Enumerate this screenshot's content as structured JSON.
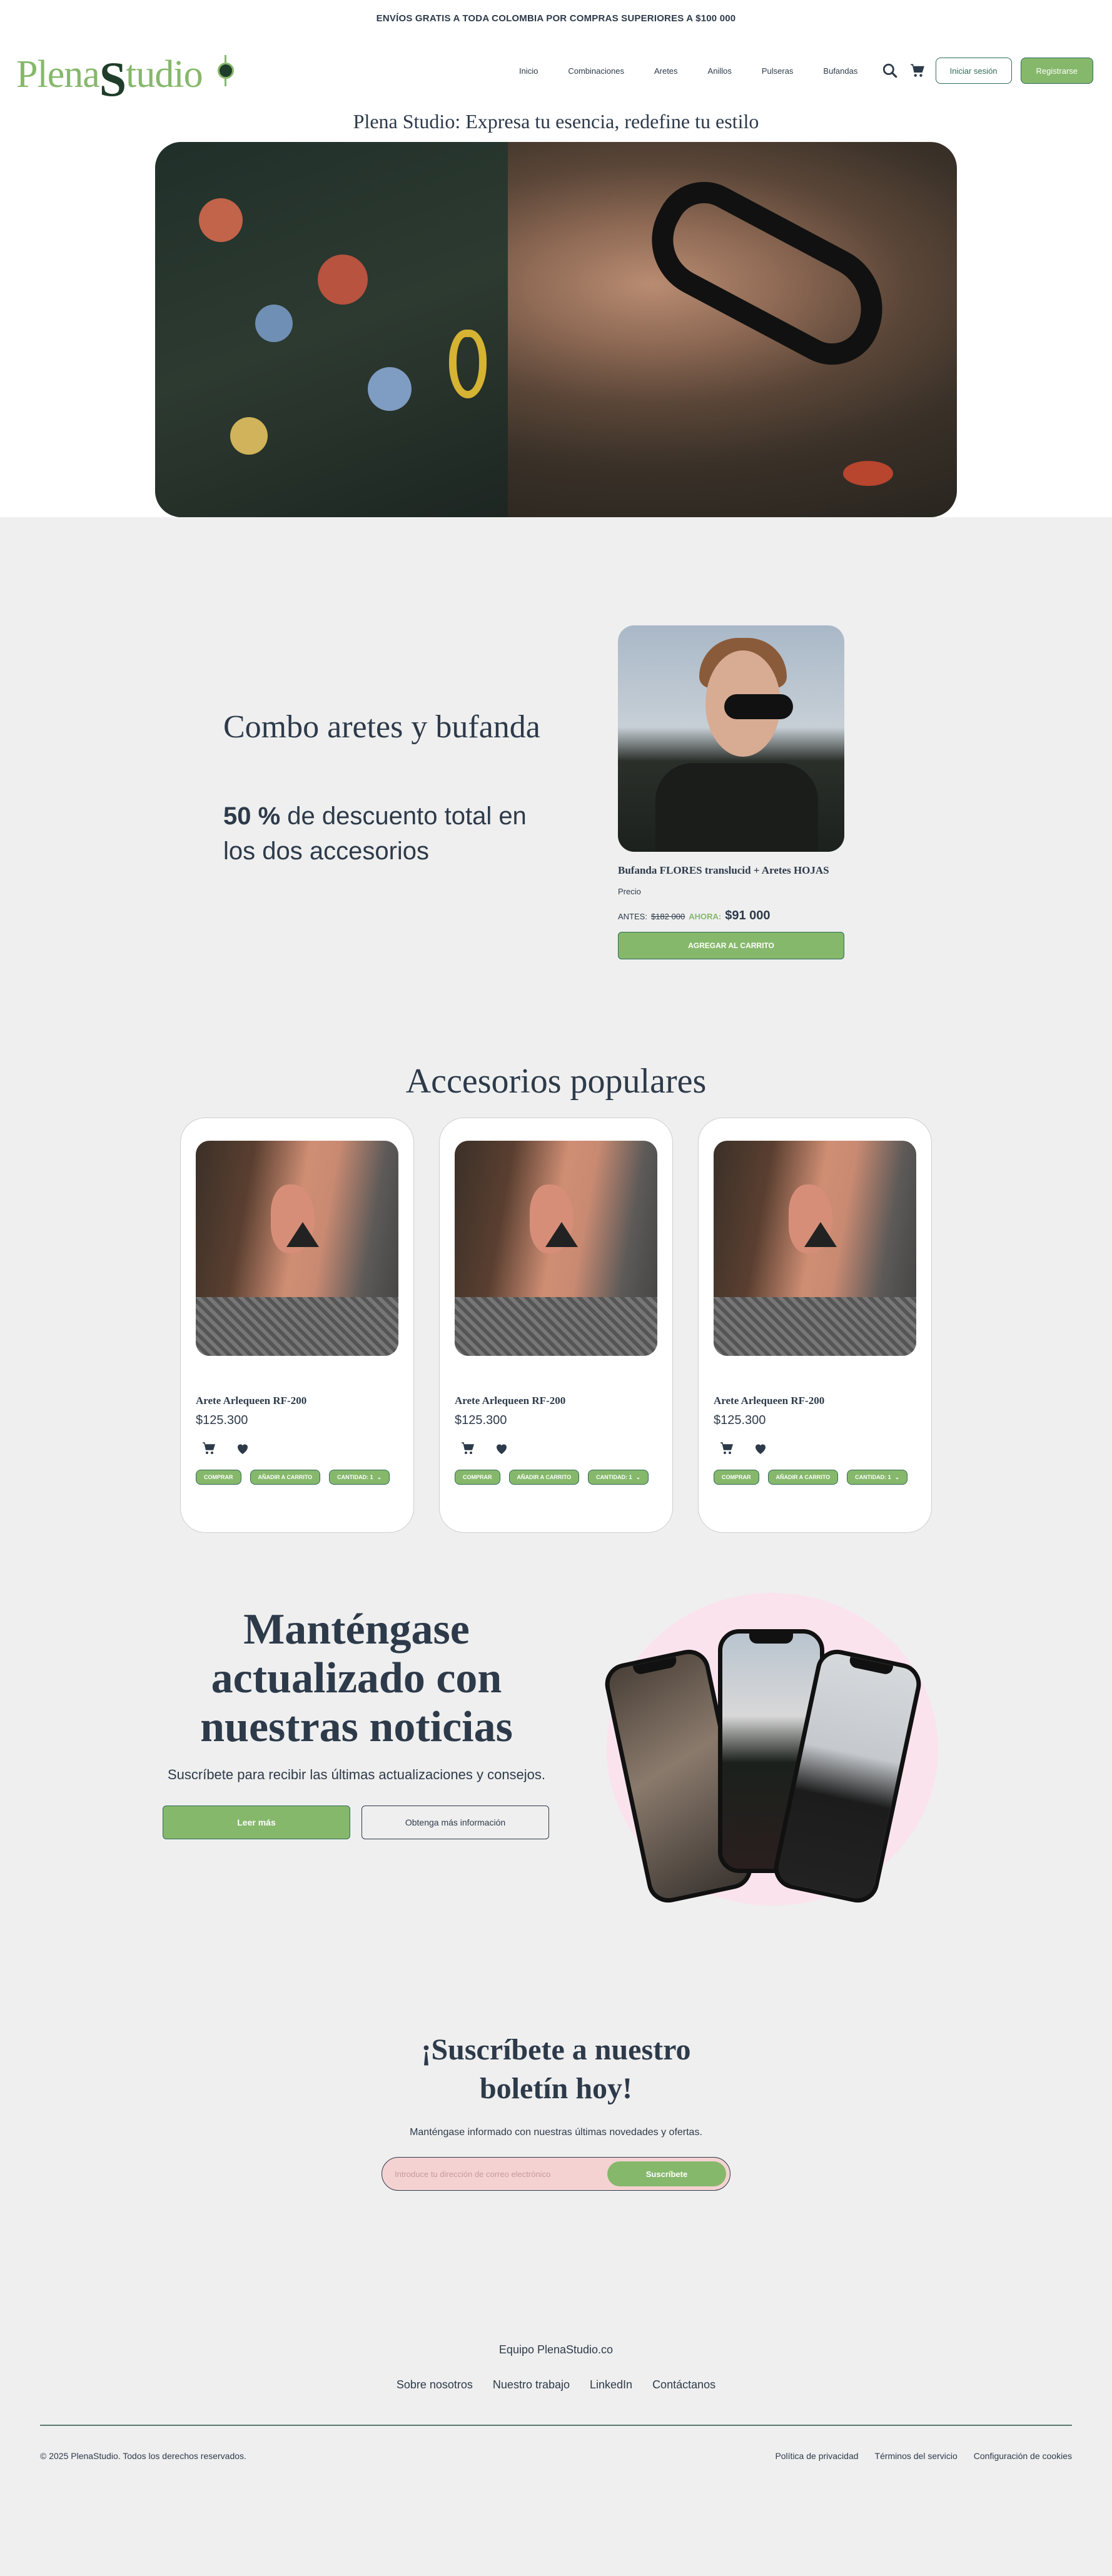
{
  "banner": {
    "text": "ENVÍOS GRATIS A TODA COLOMBIA POR COMPRAS SUPERIORES A $100 000"
  },
  "header": {
    "logo_text_a": "Plena",
    "logo_text_s": "S",
    "logo_text_b": "tudio",
    "nav": [
      "Inicio",
      "Combinaciones",
      "Aretes",
      "Anillos",
      "Pulseras",
      "Bufandas"
    ],
    "login_label": "Iniciar sesión",
    "register_label": "Registrarse"
  },
  "hero": {
    "title": "Plena Studio: Expresa tu esencia, redefine tu estilo"
  },
  "combo": {
    "title": "Combo aretes y bufanda",
    "desc_bold": "50 %",
    "desc_rest": " de descuento total en los dos accesorios",
    "product_name": "Bufanda FLORES translucid + Aretes HOJAS",
    "price_label": "Precio",
    "before_label": "ANTES:",
    "before_price": "$182 000",
    "now_label": "AHORA:",
    "now_price": "$91 000",
    "add_label": "AGREGAR AL CARRITO"
  },
  "popular": {
    "title": "Accesorios populares",
    "items": [
      {
        "name": "Arete Arlequeen RF-200",
        "price": "$125.300",
        "buy": "COMPRAR",
        "cart": "AÑADIR A CARRITO",
        "qty": "CANTIDAD: 1"
      },
      {
        "name": "Arete Arlequeen RF-200",
        "price": "$125.300",
        "buy": "COMPRAR",
        "cart": "AÑADIR A CARRITO",
        "qty": "CANTIDAD: 1"
      },
      {
        "name": "Arete Arlequeen RF-200",
        "price": "$125.300",
        "buy": "COMPRAR",
        "cart": "AÑADIR A CARRITO",
        "qty": "CANTIDAD: 1"
      }
    ]
  },
  "news": {
    "title": "Manténgase actualizado con nuestras noticias",
    "subtitle": "Suscríbete para recibir las últimas actualizaciones y consejos.",
    "primary_label": "Leer más",
    "secondary_label": "Obtenga más información"
  },
  "subscribe": {
    "title": "¡Suscríbete a nuestro boletín hoy!",
    "text": "Manténgase informado con nuestras últimas novedades y ofertas.",
    "placeholder": "Introduce tu dirección de correo electrónico",
    "button_label": "Suscríbete"
  },
  "footer": {
    "team": "Equipo PlenaStudio.co",
    "links": [
      "Sobre nosotros",
      "Nuestro trabajo",
      "LinkedIn",
      "Contáctanos"
    ],
    "copyright": "© 2025 PlenaStudio. Todos los derechos reservados.",
    "legal": [
      "Política de privacidad",
      "Términos del servicio",
      "Configuración de cookies"
    ]
  },
  "colors": {
    "accent": "#86b86b",
    "dark_green": "#1f3d2a",
    "text": "#2d3a4a",
    "background": "#efefef",
    "pink": "#fbe3ee"
  },
  "icons": [
    "search-icon",
    "cart-icon",
    "heart-icon",
    "chevron-down-icon"
  ]
}
